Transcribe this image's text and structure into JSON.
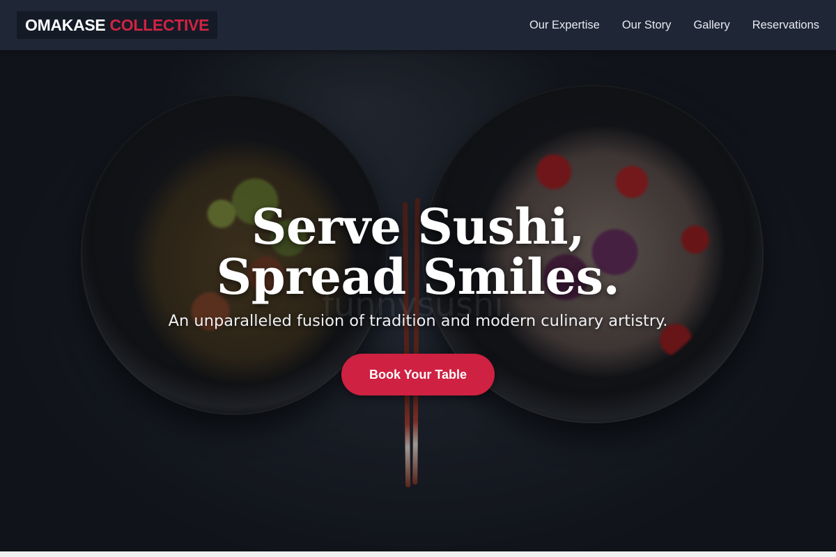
{
  "brand": {
    "word1": "OMAKASE",
    "word2": "COLLECTIVE"
  },
  "nav": {
    "items": [
      {
        "label": "Our Expertise"
      },
      {
        "label": "Our Story"
      },
      {
        "label": "Gallery"
      },
      {
        "label": "Reservations"
      }
    ]
  },
  "hero": {
    "headline": "Serve Sushi, Spread Smiles.",
    "subhead": "An unparalleled fusion of tradition and modern culinary artistry.",
    "cta_label": "Book Your Table",
    "watermark": "funnysushi."
  },
  "colors": {
    "nav_bg": "#1f2737",
    "accent": "#d12342",
    "cta_bg": "#cf2142"
  }
}
